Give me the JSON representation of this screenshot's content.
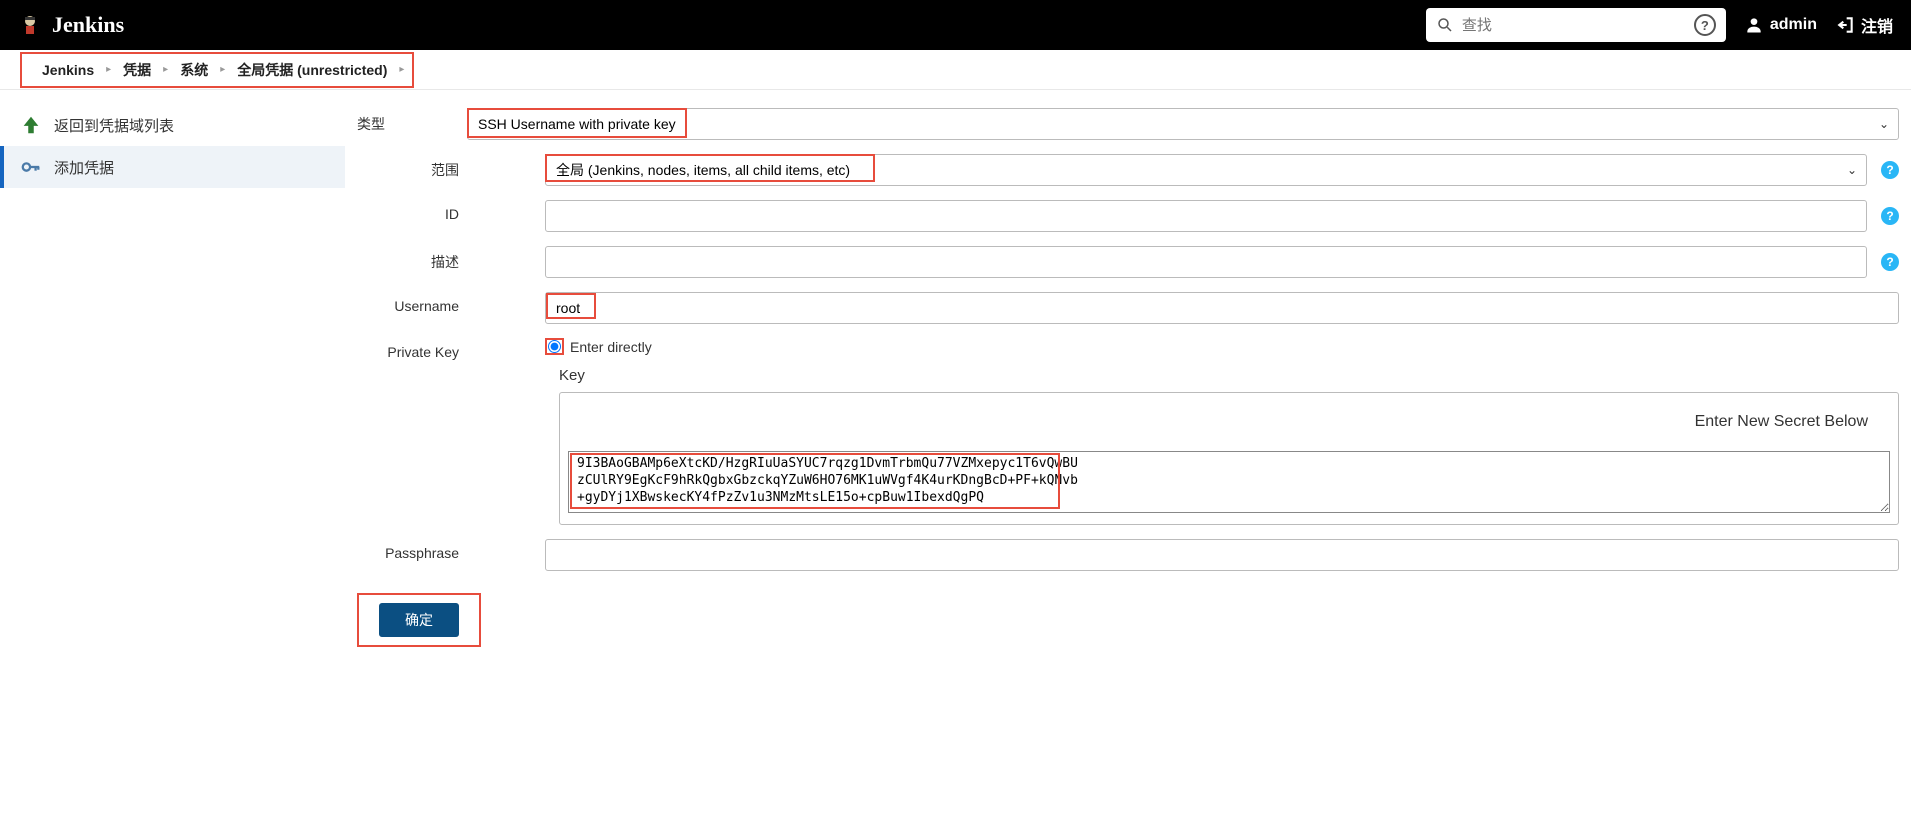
{
  "header": {
    "brand": "Jenkins",
    "search_placeholder": "查找",
    "user": "admin",
    "logout": "注销"
  },
  "breadcrumb": [
    "Jenkins",
    "凭据",
    "系统",
    "全局凭据 (unrestricted)"
  ],
  "sidebar": {
    "back_label": "返回到凭据域列表",
    "add_label": "添加凭据"
  },
  "form": {
    "type_label": "类型",
    "type_value": "SSH Username with private key",
    "scope_label": "范围",
    "scope_value": "全局 (Jenkins, nodes, items, all child items, etc)",
    "id_label": "ID",
    "id_value": "",
    "desc_label": "描述",
    "desc_value": "",
    "username_label": "Username",
    "username_value": "root",
    "pkey_label": "Private Key",
    "pkey_option": "Enter directly",
    "key_label": "Key",
    "key_header": "Enter New Secret Below",
    "key_value": "9I3BAoGBAMp6eXtcKD/HzgRIuUaSYUC7rqzg1DvmTrbmQu77VZMxepyc1T6vQwBU\nzCUlRY9EgKcF9hRkQgbxGbzckqYZuW6HO76MK1uWVgf4K4urKDngBcD+PF+kQNvb\n+gyDYj1XBwskecKY4fPzZv1u3NMzMtsLE15o+cpBuw1IbexdQgPQ",
    "passphrase_label": "Passphrase",
    "passphrase_value": "",
    "submit_label": "确定"
  }
}
